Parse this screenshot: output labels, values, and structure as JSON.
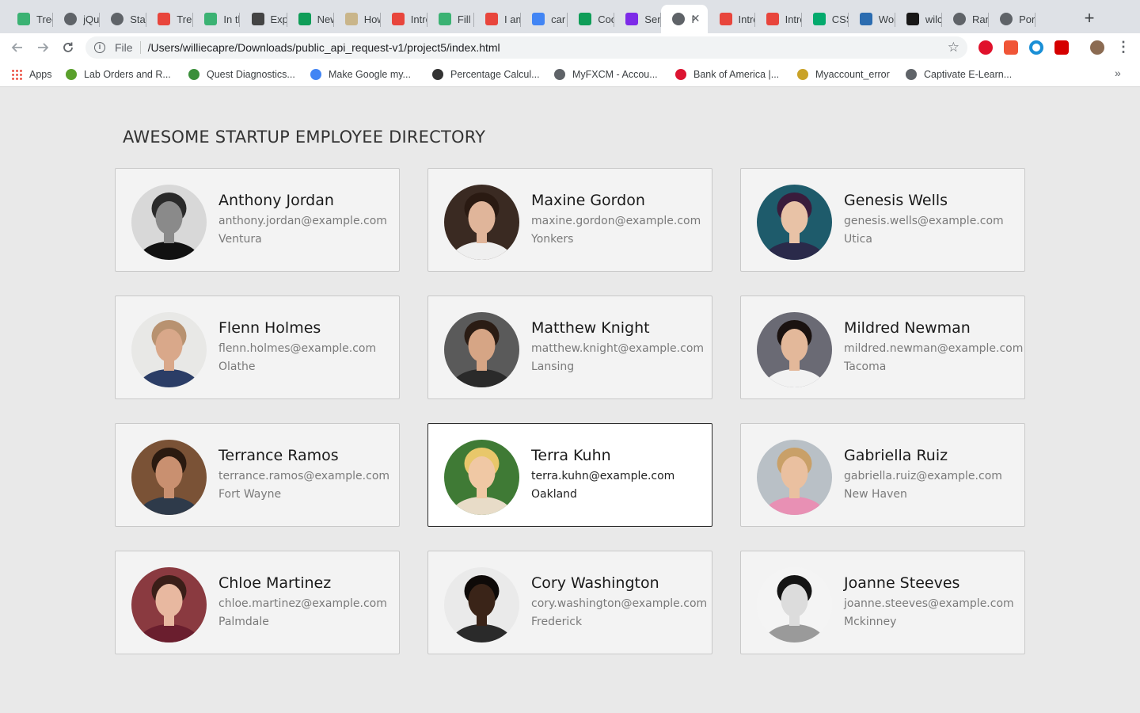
{
  "browser": {
    "tabs": [
      {
        "label": "Tree",
        "icon": "green-leaf-icon",
        "color": "#3bb273"
      },
      {
        "label": "jQue",
        "icon": "globe-icon",
        "color": "#5f6368"
      },
      {
        "label": "Star",
        "icon": "globe-icon",
        "color": "#5f6368"
      },
      {
        "label": "Tree",
        "icon": "number-20-icon",
        "color": "#e8453c"
      },
      {
        "label": "In th",
        "icon": "green-leaf-icon",
        "color": "#3bb273"
      },
      {
        "label": "Exp",
        "icon": "ex-icon",
        "color": "#444444"
      },
      {
        "label": "New",
        "icon": "sheets-icon",
        "color": "#0f9d58"
      },
      {
        "label": "How",
        "icon": "tan-square-icon",
        "color": "#c9b58a"
      },
      {
        "label": "Intro",
        "icon": "number-20-icon",
        "color": "#e8453c"
      },
      {
        "label": "Fill i",
        "icon": "green-leaf-icon",
        "color": "#3bb273"
      },
      {
        "label": "I am",
        "icon": "number-20-icon",
        "color": "#e8453c"
      },
      {
        "label": "car",
        "icon": "google-g-icon",
        "color": "#4285f4"
      },
      {
        "label": "Coo",
        "icon": "sheets-icon",
        "color": "#0f9d58"
      },
      {
        "label": "Sen",
        "icon": "canva-icon",
        "color": "#7d2ae8"
      },
      {
        "label": "I",
        "icon": "globe-icon",
        "color": "#5f6368"
      },
      {
        "label": "Intro",
        "icon": "number-20-icon",
        "color": "#e8453c"
      },
      {
        "label": "Intro",
        "icon": "number-20-icon",
        "color": "#e8453c"
      },
      {
        "label": "CSS",
        "icon": "w3-icon",
        "color": "#04aa6d"
      },
      {
        "label": "Wor",
        "icon": "mortarboard-icon",
        "color": "#2b6cb0"
      },
      {
        "label": "wilc",
        "icon": "github-icon",
        "color": "#181717"
      },
      {
        "label": "Ran",
        "icon": "globe-icon",
        "color": "#5f6368"
      },
      {
        "label": "Por",
        "icon": "globe-icon",
        "color": "#5f6368"
      }
    ],
    "active_tab_index": 14,
    "new_tab_label": "+",
    "close_glyph": "✕",
    "address": {
      "scheme": "File",
      "path": "/Users/williecapre/Downloads/public_api_request-v1/project5/index.html"
    },
    "extensions": [
      {
        "icon": "opera-icon",
        "color": "#e0112b"
      },
      {
        "icon": "pdf-icon",
        "color": "#f05537"
      },
      {
        "icon": "ring-icon",
        "color": "#1a8fd6"
      },
      {
        "icon": "red-box-icon",
        "color": "#d50000"
      }
    ],
    "bookmarks": [
      {
        "label": "Apps",
        "icon": "apps-grid-icon",
        "color": "#4285f4"
      },
      {
        "label": "Lab Orders and R...",
        "icon": "green-swirl-icon",
        "color": "#5aa02c"
      },
      {
        "label": "Quest Diagnostics...",
        "icon": "quest-icon",
        "color": "#3a8f3a"
      },
      {
        "label": "Make Google my...",
        "icon": "google-g-icon",
        "color": "#4285f4"
      },
      {
        "label": "Percentage Calcul...",
        "icon": "sigma-icon",
        "color": "#333333"
      },
      {
        "label": "MyFXCM - Accou...",
        "icon": "globe-icon",
        "color": "#5f6368"
      },
      {
        "label": "Bank of America |...",
        "icon": "boa-flag-icon",
        "color": "#dc1431"
      },
      {
        "label": "Myaccount_error",
        "icon": "bee-icon",
        "color": "#c9a227"
      },
      {
        "label": "Captivate E-Learn...",
        "icon": "globe-icon",
        "color": "#5f6368"
      }
    ],
    "more_bookmarks": "»"
  },
  "page": {
    "title": "AWESOME STARTUP EMPLOYEE DIRECTORY",
    "employees": [
      {
        "name": "Anthony Jordan",
        "email": "anthony.jordan@example.com",
        "city": "Ventura",
        "avatar": {
          "bg": "#d8d8d8",
          "skin": "#8a8a8a",
          "hair": "#2a2a2a",
          "shirt": "#111111"
        }
      },
      {
        "name": "Maxine Gordon",
        "email": "maxine.gordon@example.com",
        "city": "Yonkers",
        "avatar": {
          "bg": "#3a2a22",
          "skin": "#e0b59a",
          "hair": "#2a1a12",
          "shirt": "#efefef"
        }
      },
      {
        "name": "Genesis Wells",
        "email": "genesis.wells@example.com",
        "city": "Utica",
        "avatar": {
          "bg": "#1e5b6b",
          "skin": "#e8c2a6",
          "hair": "#3a1c3c",
          "shirt": "#2a2a4a"
        }
      },
      {
        "name": "Flenn Holmes",
        "email": "flenn.holmes@example.com",
        "city": "Olathe",
        "avatar": {
          "bg": "#e8e8e6",
          "skin": "#d9a88a",
          "hair": "#b89270",
          "shirt": "#2b3d66"
        }
      },
      {
        "name": "Matthew Knight",
        "email": "matthew.knight@example.com",
        "city": "Lansing",
        "avatar": {
          "bg": "#5a5a5a",
          "skin": "#d6a585",
          "hair": "#2a1c14",
          "shirt": "#2a2a2a"
        }
      },
      {
        "name": "Mildred Newman",
        "email": "mildred.newman@example.com",
        "city": "Tacoma",
        "avatar": {
          "bg": "#6a6a74",
          "skin": "#e3b89a",
          "hair": "#1a1210",
          "shirt": "#f2f2f2"
        }
      },
      {
        "name": "Terrance Ramos",
        "email": "terrance.ramos@example.com",
        "city": "Fort Wayne",
        "avatar": {
          "bg": "#7a5236",
          "skin": "#c99070",
          "hair": "#2a1a10",
          "shirt": "#2e3a4a"
        }
      },
      {
        "name": "Terra Kuhn",
        "email": "terra.kuhn@example.com",
        "city": "Oakland",
        "avatar": {
          "bg": "#3f7a35",
          "skin": "#f0c8a4",
          "hair": "#e8c76a",
          "shirt": "#e8dcc8"
        }
      },
      {
        "name": "Gabriella Ruiz",
        "email": "gabriella.ruiz@example.com",
        "city": "New Haven",
        "avatar": {
          "bg": "#b9c0c6",
          "skin": "#eac0a0",
          "hair": "#c9a068",
          "shirt": "#e890b4"
        }
      },
      {
        "name": "Chloe Martinez",
        "email": "chloe.martinez@example.com",
        "city": "Palmdale",
        "avatar": {
          "bg": "#8a3a40",
          "skin": "#e8b8a0",
          "hair": "#3a1e18",
          "shirt": "#6a1e2e"
        }
      },
      {
        "name": "Cory Washington",
        "email": "cory.washington@example.com",
        "city": "Frederick",
        "avatar": {
          "bg": "#eaeaea",
          "skin": "#3a2418",
          "hair": "#0e0a08",
          "shirt": "#2a2a2a"
        }
      },
      {
        "name": "Joanne Steeves",
        "email": "joanne.steeves@example.com",
        "city": "Mckinney",
        "avatar": {
          "bg": "#f4f4f4",
          "skin": "#dcdcdc",
          "hair": "#141414",
          "shirt": "#9a9a9a"
        }
      }
    ],
    "hovered_index": 7
  }
}
